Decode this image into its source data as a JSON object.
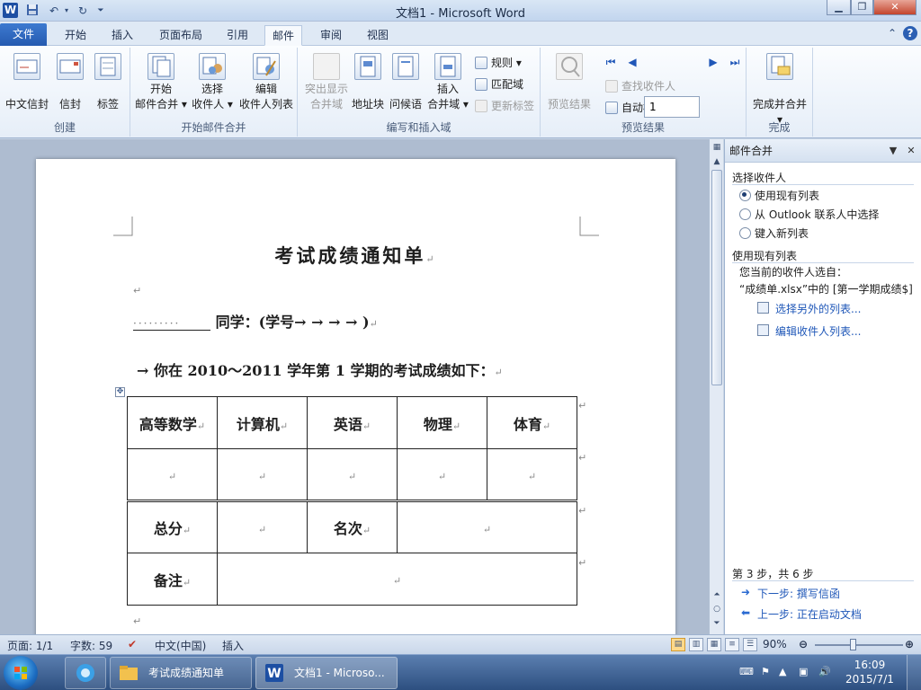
{
  "window": {
    "title": "文档1 - Microsoft Word",
    "word_icon": "W",
    "qat_icons": [
      "save-icon",
      "undo-icon",
      "redo-icon",
      "customize-qat-icon"
    ]
  },
  "tabs": [
    {
      "label": "文件"
    },
    {
      "label": "开始"
    },
    {
      "label": "插入"
    },
    {
      "label": "页面布局"
    },
    {
      "label": "引用"
    },
    {
      "label": "邮件"
    },
    {
      "label": "审阅"
    },
    {
      "label": "视图"
    }
  ],
  "active_tab": "邮件",
  "ribbon": {
    "groups": {
      "create": "创建",
      "start": "开始邮件合并",
      "write": "编写和插入域",
      "preview": "预览结果",
      "finish": "完成"
    },
    "create": {
      "cn_envelope": "中文信封",
      "envelope": "信封",
      "labels": "标签"
    },
    "start": {
      "start_l1": "开始",
      "start_l2": "邮件合并",
      "select_l1": "选择",
      "select_l2": "收件人",
      "edit_l1": "编辑",
      "edit_l2": "收件人列表"
    },
    "write": {
      "highlight_l1": "突出显示",
      "highlight_l2": "合并域",
      "address_block": "地址块",
      "greeting": "问候语",
      "insert_l1": "插入",
      "insert_l2": "合并域",
      "rules": "规则",
      "match_fields": "匹配域",
      "update_labels": "更新标签"
    },
    "preview": {
      "preview_results": "预览结果",
      "record_value": "1",
      "find_recipient": "查找收件人",
      "auto_check": "自动检查错误"
    },
    "finish": {
      "finish_merge": "完成并合并"
    }
  },
  "document": {
    "title": "考试成绩通知单",
    "line1_blank": "·········",
    "line1_text": "同学：(学号→ → → → )",
    "line2_text": "→ 你在 2010～2011 学年第 1 学期的考试成绩如下：",
    "para_mark": "↵",
    "table": {
      "headers": [
        "高等数学",
        "计算机",
        "英语",
        "物理",
        "体育"
      ],
      "row2_marks": [
        "↵",
        "↵",
        "↵",
        "↵",
        "↵"
      ],
      "total_label": "总分",
      "rank_label": "名次",
      "remark_label": "备注"
    }
  },
  "taskpane": {
    "title": "邮件合并",
    "section_select": "选择收件人",
    "options": [
      "使用现有列表",
      "从 Outlook 联系人中选择",
      "键入新列表"
    ],
    "checked_option": 0,
    "section_use": "使用现有列表",
    "current_from": "您当前的收件人选自：",
    "source": "“成绩单.xlsx”中的 [第一学期成绩$]",
    "link_select_other": "选择另外的列表...",
    "link_edit": "编辑收件人列表...",
    "step": "第 3 步，共 6 步",
    "next": "下一步: 撰写信函",
    "prev": "上一步: 正在启动文档"
  },
  "statusbar": {
    "page": "页面: 1/1",
    "words": "字数: 59",
    "language": "中文(中国)",
    "mode": "插入",
    "zoom": "90%"
  },
  "taskbar": {
    "apps": [
      {
        "label": "考试成绩通知单",
        "icon": "folder-icon"
      },
      {
        "label": "文档1 - Microso...",
        "icon": "word-icon"
      }
    ],
    "time": "16:09",
    "date": "2015/7/1"
  },
  "colors": {
    "accent": "#2b5fb3",
    "file_tab": "#2f68c0",
    "link": "#1f57b8"
  }
}
